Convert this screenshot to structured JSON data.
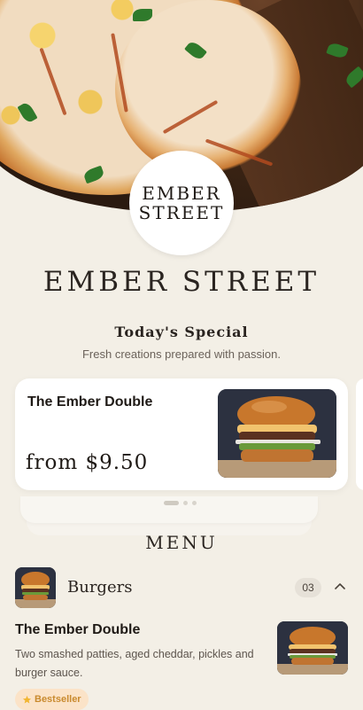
{
  "logo": {
    "line1": "EMBER",
    "line2": "STREET"
  },
  "brand_title": "EMBER STREET",
  "special": {
    "title": "Today's Special",
    "subtitle": "Fresh creations prepared with passion.",
    "card": {
      "name": "The Ember Double",
      "price": "from $9.50"
    },
    "carousel": {
      "active_index": 0,
      "count": 3
    }
  },
  "menu": {
    "title": "MENU",
    "category": {
      "name": "Burgers",
      "count": "03",
      "expanded": true
    },
    "item": {
      "name": "The Ember Double",
      "description": "Two smashed patties, aged cheddar, pickles and burger sauce.",
      "badge": "Bestseller"
    }
  },
  "icons": {
    "chevron": "chevron-up-icon",
    "badge": "star-icon"
  },
  "colors": {
    "background": "#f3efe6",
    "badge_bg": "#fbe3c8",
    "badge_text": "#c98a2e"
  }
}
